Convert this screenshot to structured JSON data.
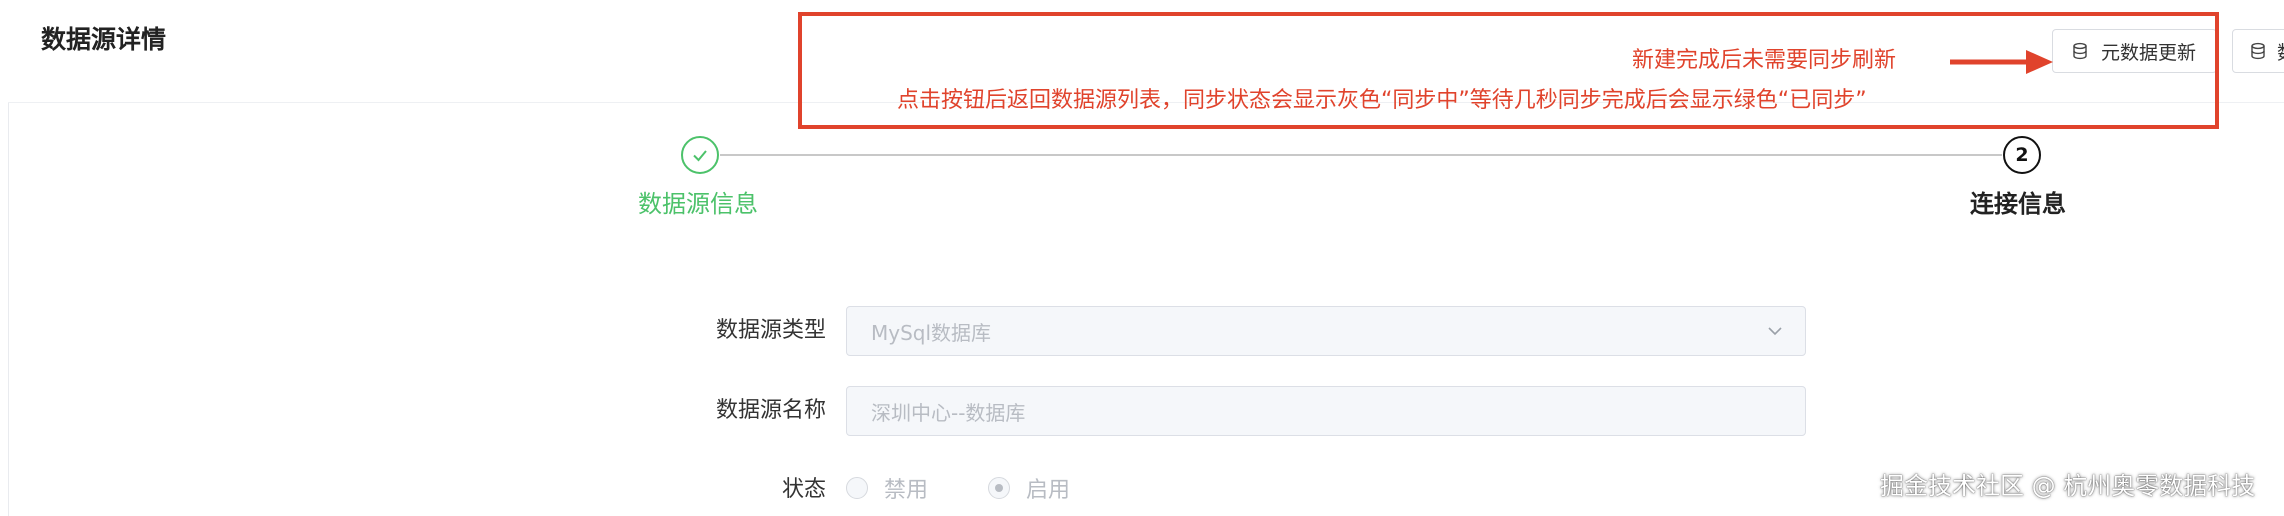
{
  "header": {
    "title": "数据源详情",
    "buttons": [
      {
        "label": "元数据更新",
        "icon": "database-icon"
      },
      {
        "label": "数",
        "icon": "database-icon"
      }
    ]
  },
  "annotation": {
    "line1": "新建完成后未需要同步刷新",
    "line2": "点击按钮后返回数据源列表，同步状态会显示灰色“同步中”等待几秒同步完成后会显示绿色“已同步”",
    "color": "#e0432c"
  },
  "steps": [
    {
      "label": "数据源信息",
      "status": "done",
      "icon": "check-icon",
      "color": "#4cc26a"
    },
    {
      "label": "连接信息",
      "status": "current",
      "number": "2"
    }
  ],
  "form": {
    "type_label": "数据源类型",
    "type_placeholder": "MySql数据库",
    "name_label": "数据源名称",
    "name_placeholder": "深圳中心--数据库",
    "status_label": "状态",
    "status_options": [
      {
        "label": "禁用",
        "checked": false
      },
      {
        "label": "启用",
        "checked": true
      }
    ]
  },
  "watermark": "掘金技术社区 @ 杭州奥零数据科技"
}
